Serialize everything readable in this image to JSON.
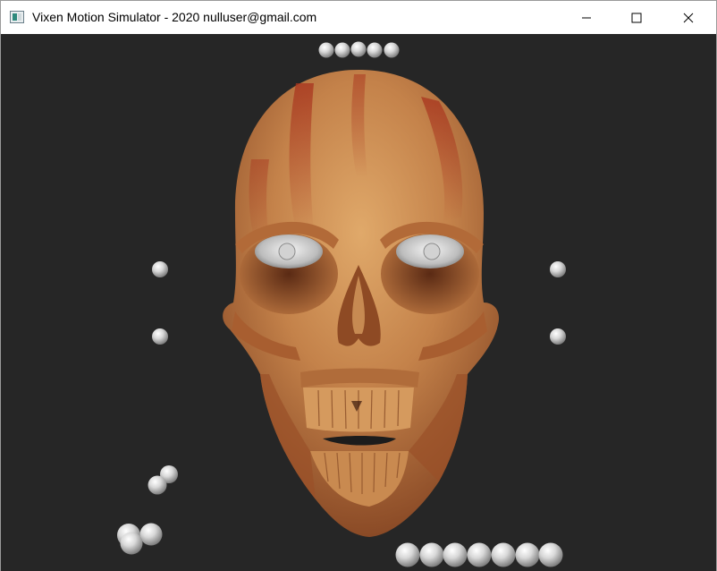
{
  "window": {
    "title": "Vixen Motion Simulator - 2020 nulluser@gmail.com"
  },
  "icons": {
    "app": "app-window-icon",
    "minimize": "minimize-icon",
    "maximize": "maximize-icon",
    "close": "close-icon"
  },
  "scene": {
    "background": "#262626",
    "skull_color": "#c4824a",
    "sphere_color": "#dcdcdc"
  }
}
